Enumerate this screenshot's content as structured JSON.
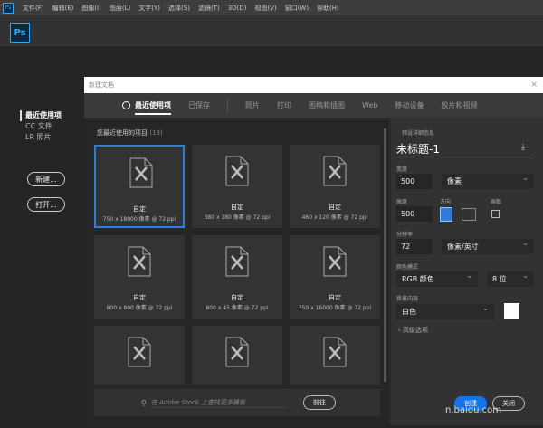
{
  "menu": [
    "文件(F)",
    "编辑(E)",
    "图像(I)",
    "图层(L)",
    "文字(Y)",
    "选择(S)",
    "滤镜(T)",
    "3D(D)",
    "视图(V)",
    "窗口(W)",
    "帮助(H)"
  ],
  "app_logo": "Ps",
  "sidebar": {
    "items": [
      "最近使用项",
      "CC 文件",
      "LR 照片"
    ],
    "new_btn": "新建...",
    "open_btn": "打开..."
  },
  "dialog": {
    "title": "新建文档",
    "close": "×",
    "tabs": [
      "最近使用项",
      "已保存",
      "照片",
      "打印",
      "图稿和插图",
      "Web",
      "移动设备",
      "胶片和视频"
    ],
    "recent_title": "您最近使用的项目",
    "recent_count": "(19)",
    "tiles": [
      {
        "name": "自定",
        "desc": "750 x 18000 像素 @ 72 ppi"
      },
      {
        "name": "自定",
        "desc": "380 x 180 像素 @ 72 ppi"
      },
      {
        "name": "自定",
        "desc": "460 x 120 像素 @ 72 ppi"
      },
      {
        "name": "自定",
        "desc": "800 x 800 像素 @ 72 ppi"
      },
      {
        "name": "自定",
        "desc": "800 x 45 像素 @ 72 ppi"
      },
      {
        "name": "自定",
        "desc": "750 x 16000 像素 @ 72 ppi"
      },
      {
        "name": "",
        "desc": ""
      },
      {
        "name": "",
        "desc": ""
      },
      {
        "name": "",
        "desc": ""
      }
    ],
    "search_placeholder": "在 Adobe Stock 上查找更多模板",
    "go": "前往",
    "preset": {
      "header": "预设详细信息",
      "doc_name": "未标题-1",
      "width_label": "宽度",
      "width": "500",
      "width_unit": "像素",
      "height_label": "高度",
      "height": "500",
      "orient_label": "方向",
      "artboard_label": "画板",
      "res_label": "分辨率",
      "res": "72",
      "res_unit": "像素/英寸",
      "mode_label": "颜色模式",
      "mode": "RGB 颜色",
      "bits": "8 位",
      "bg_label": "背景内容",
      "bg": "白色",
      "advanced": "高级选项"
    },
    "create": "创建",
    "close_btn": "关闭"
  },
  "watermark": "n.baidu.com"
}
